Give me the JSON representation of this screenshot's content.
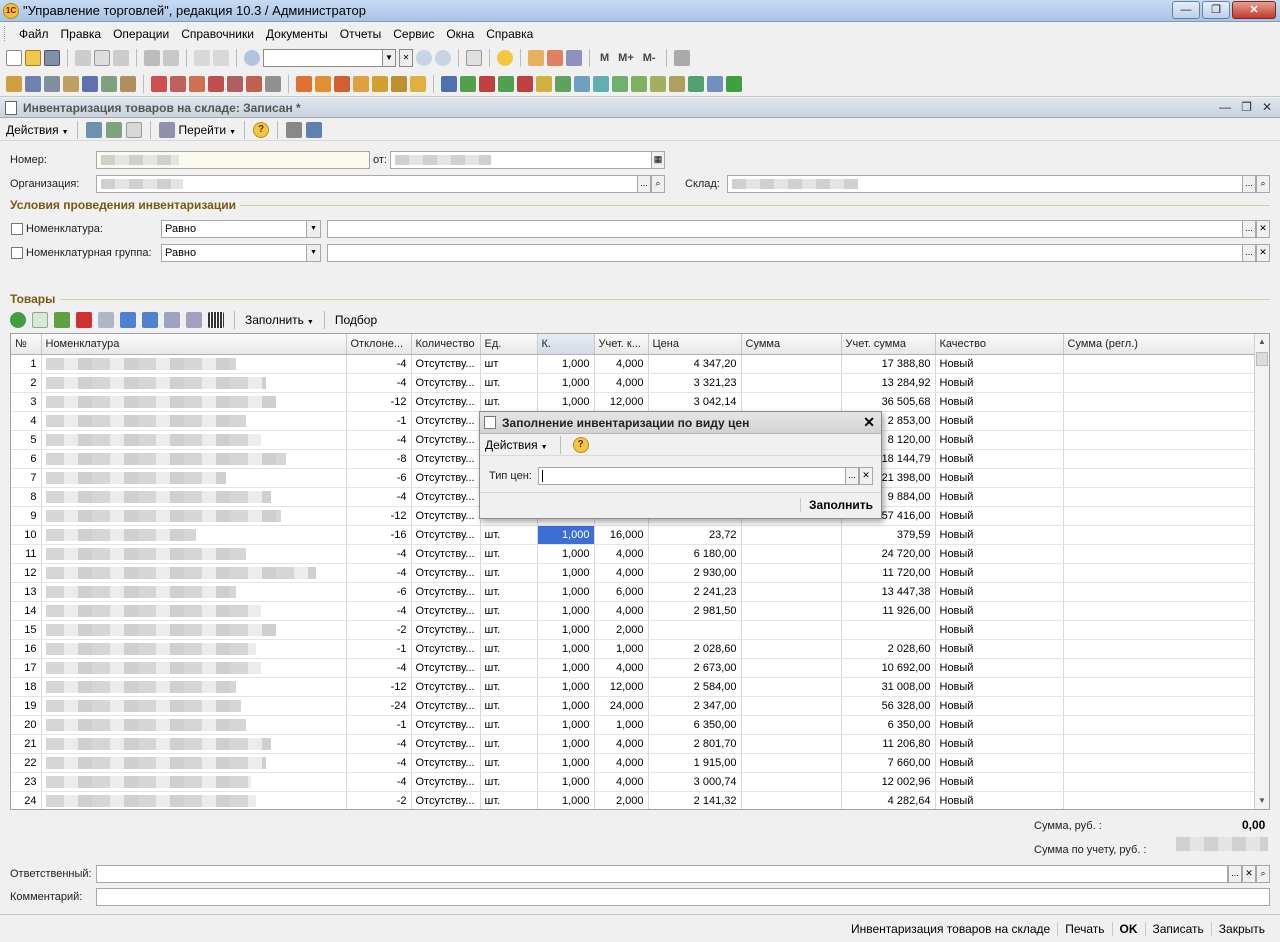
{
  "window": {
    "title": "\"Управление торговлей\", редакция 10.3 / Администратор",
    "minimize": "—",
    "maximize": "❐",
    "close": "✕"
  },
  "menu": [
    "Файл",
    "Правка",
    "Операции",
    "Справочники",
    "Документы",
    "Отчеты",
    "Сервис",
    "Окна",
    "Справка"
  ],
  "toolbar": {
    "m": "M",
    "m_plus": "M+",
    "m_minus": "M-"
  },
  "document": {
    "title": "Инвентаризация товаров на складе: Записан *",
    "actions_label": "Действия",
    "goto_label": "Перейти",
    "number_label": "Номер:",
    "date_label": "от:",
    "org_label": "Организация:",
    "warehouse_label": "Склад:",
    "conditions_title": "Условия проведения инвентаризации",
    "cond_nomenclature_label": "Номенклатура:",
    "cond_group_label": "Номенклатурная группа:",
    "cond_nomenclature_op": "Равно",
    "cond_group_op": "Равно",
    "goods_title": "Товары",
    "fill_label": "Заполнить",
    "selection_label": "Подбор",
    "total_sum_label": "Сумма, руб. :",
    "total_sum_value": "0,00",
    "total_account_label": "Сумма по учету, руб. :",
    "responsible_label": "Ответственный:",
    "comment_label": "Комментарий:"
  },
  "table": {
    "columns": [
      "№",
      "Номенклатура",
      "Отклоне...",
      "Количество",
      "Ед.",
      "К.",
      "Учет. к...",
      "Цена",
      "Сумма",
      "Учет. сумма",
      "Качество",
      "Сумма (регл.)"
    ],
    "rows": [
      {
        "n": "1",
        "dev": "-4",
        "qty": "Отсутству...",
        "unit": "шт",
        "k": "1,000",
        "acc": "4,000",
        "price": "4 347,20",
        "sum": "",
        "accsum": "17 388,80",
        "quality": "Новый"
      },
      {
        "n": "2",
        "dev": "-4",
        "qty": "Отсутству...",
        "unit": "шт.",
        "k": "1,000",
        "acc": "4,000",
        "price": "3 321,23",
        "sum": "",
        "accsum": "13 284,92",
        "quality": "Новый"
      },
      {
        "n": "3",
        "dev": "-12",
        "qty": "Отсутству...",
        "unit": "шт.",
        "k": "1,000",
        "acc": "12,000",
        "price": "3 042,14",
        "sum": "",
        "accsum": "36 505,68",
        "quality": "Новый"
      },
      {
        "n": "4",
        "dev": "-1",
        "qty": "Отсутству...",
        "unit": "",
        "k": "",
        "acc": "",
        "price": "",
        "sum": "",
        "accsum": "2 853,00",
        "quality": "Новый"
      },
      {
        "n": "5",
        "dev": "-4",
        "qty": "Отсутству...",
        "unit": "",
        "k": "",
        "acc": "",
        "price": "",
        "sum": "",
        "accsum": "8 120,00",
        "quality": "Новый"
      },
      {
        "n": "6",
        "dev": "-8",
        "qty": "Отсутству...",
        "unit": "",
        "k": "",
        "acc": "",
        "price": "",
        "sum": "",
        "accsum": "18 144,79",
        "quality": "Новый"
      },
      {
        "n": "7",
        "dev": "-6",
        "qty": "Отсутству...",
        "unit": "",
        "k": "",
        "acc": "",
        "price": "",
        "sum": "",
        "accsum": "21 398,00",
        "quality": "Новый"
      },
      {
        "n": "8",
        "dev": "-4",
        "qty": "Отсутству...",
        "unit": "",
        "k": "",
        "acc": "",
        "price": "",
        "sum": "",
        "accsum": "9 884,00",
        "quality": "Новый"
      },
      {
        "n": "9",
        "dev": "-12",
        "qty": "Отсутству...",
        "unit": "",
        "k": "",
        "acc": "",
        "price": "",
        "sum": "",
        "accsum": "57 416,00",
        "quality": "Новый"
      },
      {
        "n": "10",
        "dev": "-16",
        "qty": "Отсутству...",
        "unit": "шт.",
        "k": "1,000",
        "acc": "16,000",
        "price": "23,72",
        "sum": "",
        "accsum": "379,59",
        "quality": "Новый"
      },
      {
        "n": "11",
        "dev": "-4",
        "qty": "Отсутству...",
        "unit": "шт.",
        "k": "1,000",
        "acc": "4,000",
        "price": "6 180,00",
        "sum": "",
        "accsum": "24 720,00",
        "quality": "Новый"
      },
      {
        "n": "12",
        "dev": "-4",
        "qty": "Отсутству...",
        "unit": "шт.",
        "k": "1,000",
        "acc": "4,000",
        "price": "2 930,00",
        "sum": "",
        "accsum": "11 720,00",
        "quality": "Новый"
      },
      {
        "n": "13",
        "dev": "-6",
        "qty": "Отсутству...",
        "unit": "шт.",
        "k": "1,000",
        "acc": "6,000",
        "price": "2 241,23",
        "sum": "",
        "accsum": "13 447,38",
        "quality": "Новый"
      },
      {
        "n": "14",
        "dev": "-4",
        "qty": "Отсутству...",
        "unit": "шт.",
        "k": "1,000",
        "acc": "4,000",
        "price": "2 981,50",
        "sum": "",
        "accsum": "11 926,00",
        "quality": "Новый"
      },
      {
        "n": "15",
        "dev": "-2",
        "qty": "Отсутству...",
        "unit": "шт.",
        "k": "1,000",
        "acc": "2,000",
        "price": "",
        "sum": "",
        "accsum": "",
        "quality": "Новый"
      },
      {
        "n": "16",
        "dev": "-1",
        "qty": "Отсутству...",
        "unit": "шт.",
        "k": "1,000",
        "acc": "1,000",
        "price": "2 028,60",
        "sum": "",
        "accsum": "2 028,60",
        "quality": "Новый"
      },
      {
        "n": "17",
        "dev": "-4",
        "qty": "Отсутству...",
        "unit": "шт.",
        "k": "1,000",
        "acc": "4,000",
        "price": "2 673,00",
        "sum": "",
        "accsum": "10 692,00",
        "quality": "Новый"
      },
      {
        "n": "18",
        "dev": "-12",
        "qty": "Отсутству...",
        "unit": "шт.",
        "k": "1,000",
        "acc": "12,000",
        "price": "2 584,00",
        "sum": "",
        "accsum": "31 008,00",
        "quality": "Новый"
      },
      {
        "n": "19",
        "dev": "-24",
        "qty": "Отсутству...",
        "unit": "шт.",
        "k": "1,000",
        "acc": "24,000",
        "price": "2 347,00",
        "sum": "",
        "accsum": "56 328,00",
        "quality": "Новый"
      },
      {
        "n": "20",
        "dev": "-1",
        "qty": "Отсутству...",
        "unit": "шт.",
        "k": "1,000",
        "acc": "1,000",
        "price": "6 350,00",
        "sum": "",
        "accsum": "6 350,00",
        "quality": "Новый"
      },
      {
        "n": "21",
        "dev": "-4",
        "qty": "Отсутству...",
        "unit": "шт.",
        "k": "1,000",
        "acc": "4,000",
        "price": "2 801,70",
        "sum": "",
        "accsum": "11 206,80",
        "quality": "Новый"
      },
      {
        "n": "22",
        "dev": "-4",
        "qty": "Отсутству...",
        "unit": "шт.",
        "k": "1,000",
        "acc": "4,000",
        "price": "1 915,00",
        "sum": "",
        "accsum": "7 660,00",
        "quality": "Новый"
      },
      {
        "n": "23",
        "dev": "-4",
        "qty": "Отсутству...",
        "unit": "шт.",
        "k": "1,000",
        "acc": "4,000",
        "price": "3 000,74",
        "sum": "",
        "accsum": "12 002,96",
        "quality": "Новый"
      },
      {
        "n": "24",
        "dev": "-2",
        "qty": "Отсутству...",
        "unit": "шт.",
        "k": "1,000",
        "acc": "2,000",
        "price": "2 141,32",
        "sum": "",
        "accsum": "4 282,64",
        "quality": "Новый"
      }
    ]
  },
  "modal": {
    "title": "Заполнение инвентаризации по виду цен",
    "actions_label": "Действия",
    "price_type_label": "Тип цен:",
    "fill_button": "Заполнить"
  },
  "footer": {
    "doc_name": "Инвентаризация товаров на складе",
    "print": "Печать",
    "ok": "OK",
    "save": "Записать",
    "close": "Закрыть"
  },
  "colors": {
    "selection": "#3c6fd2",
    "section_title": "#7a5a10"
  }
}
